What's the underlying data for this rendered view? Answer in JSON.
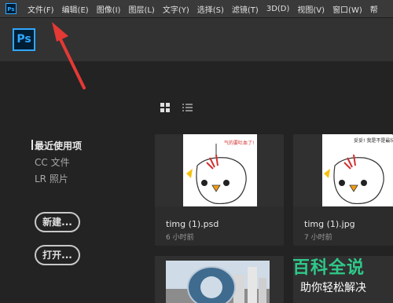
{
  "menubar": {
    "app_icon": "Ps",
    "items": [
      "文件(F)",
      "编辑(E)",
      "图像(I)",
      "图层(L)",
      "文字(Y)",
      "选择(S)",
      "滤镜(T)",
      "3D(D)",
      "视图(V)",
      "窗口(W)",
      "帮"
    ]
  },
  "header": {
    "logo": "Ps"
  },
  "view": {
    "grid_icon": "grid-icon",
    "list_icon": "list-icon",
    "selected": "grid"
  },
  "sidebar": {
    "items": [
      {
        "label": "最近使用项",
        "active": true
      },
      {
        "label": "CC 文件",
        "active": false
      },
      {
        "label": "LR 照片",
        "active": false
      }
    ],
    "new_button": "新建...",
    "open_button": "打开..."
  },
  "recent_files": [
    {
      "name": "timg (1).psd",
      "time": "6 小时前",
      "thumb_caption": "气的要吐血了!"
    },
    {
      "name": "timg (1).jpg",
      "time": "7 小时前",
      "thumb_caption": "妥妥! 我是不是最坑了?"
    }
  ],
  "watermark": {
    "title": "百科全说",
    "subtitle": "助你轻松解决"
  },
  "colors": {
    "accent": "#31a8ff",
    "annotation": "#e53935",
    "watermark": "#2fc98a"
  }
}
